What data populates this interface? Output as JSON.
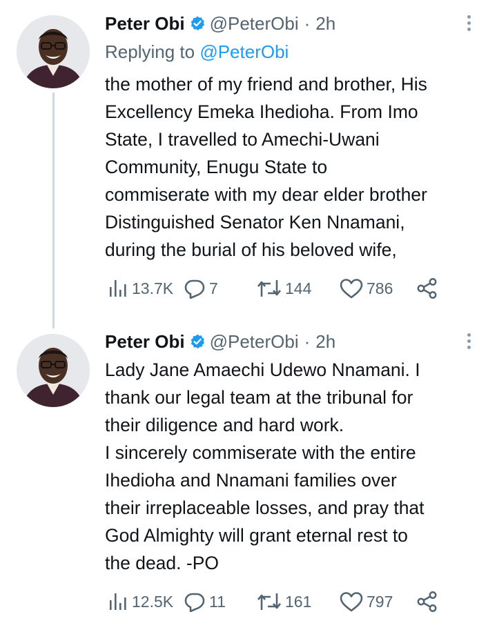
{
  "tweets": [
    {
      "author_name": "Peter Obi",
      "handle": "@PeterObi",
      "separator": "·",
      "time": "2h",
      "replying_prefix": "Replying to",
      "replying_to": "@PeterObi",
      "lines": [
        "the mother of my friend and brother, His",
        "Excellency Emeka Ihedioha. From Imo",
        "State, I travelled to Amechi-Uwani",
        "Community, Enugu State to",
        "commiserate with my dear elder brother",
        "Distinguished Senator Ken Nnamani,",
        "during the burial of his beloved wife,"
      ],
      "views": "13.7K",
      "replies": "7",
      "retweets": "144",
      "likes": "786"
    },
    {
      "author_name": "Peter Obi",
      "handle": "@PeterObi",
      "separator": "·",
      "time": "2h",
      "lines": [
        "Lady Jane Amaechi Udewo Nnamani. I",
        "thank our legal team at the tribunal for",
        "their diligence and hard work.",
        "I sincerely commiserate with the entire",
        "Ihedioha and Nnamani families over",
        "their irreplaceable losses, and pray that",
        "God Almighty will grant eternal rest to",
        "the dead. -PO"
      ],
      "views": "12.5K",
      "replies": "11",
      "retweets": "161",
      "likes": "797"
    }
  ],
  "colors": {
    "verified_badge": "#1d9bf0",
    "mention": "#1d9bf0",
    "muted_text": "#536471",
    "thread_line": "#cfd9de"
  },
  "icons": {
    "verified": "verified-badge-icon",
    "more": "more-dots-icon",
    "views": "views-bar-chart-icon",
    "reply": "reply-bubble-icon",
    "retweet": "retweet-icon",
    "like": "heart-icon",
    "share": "share-icon"
  }
}
